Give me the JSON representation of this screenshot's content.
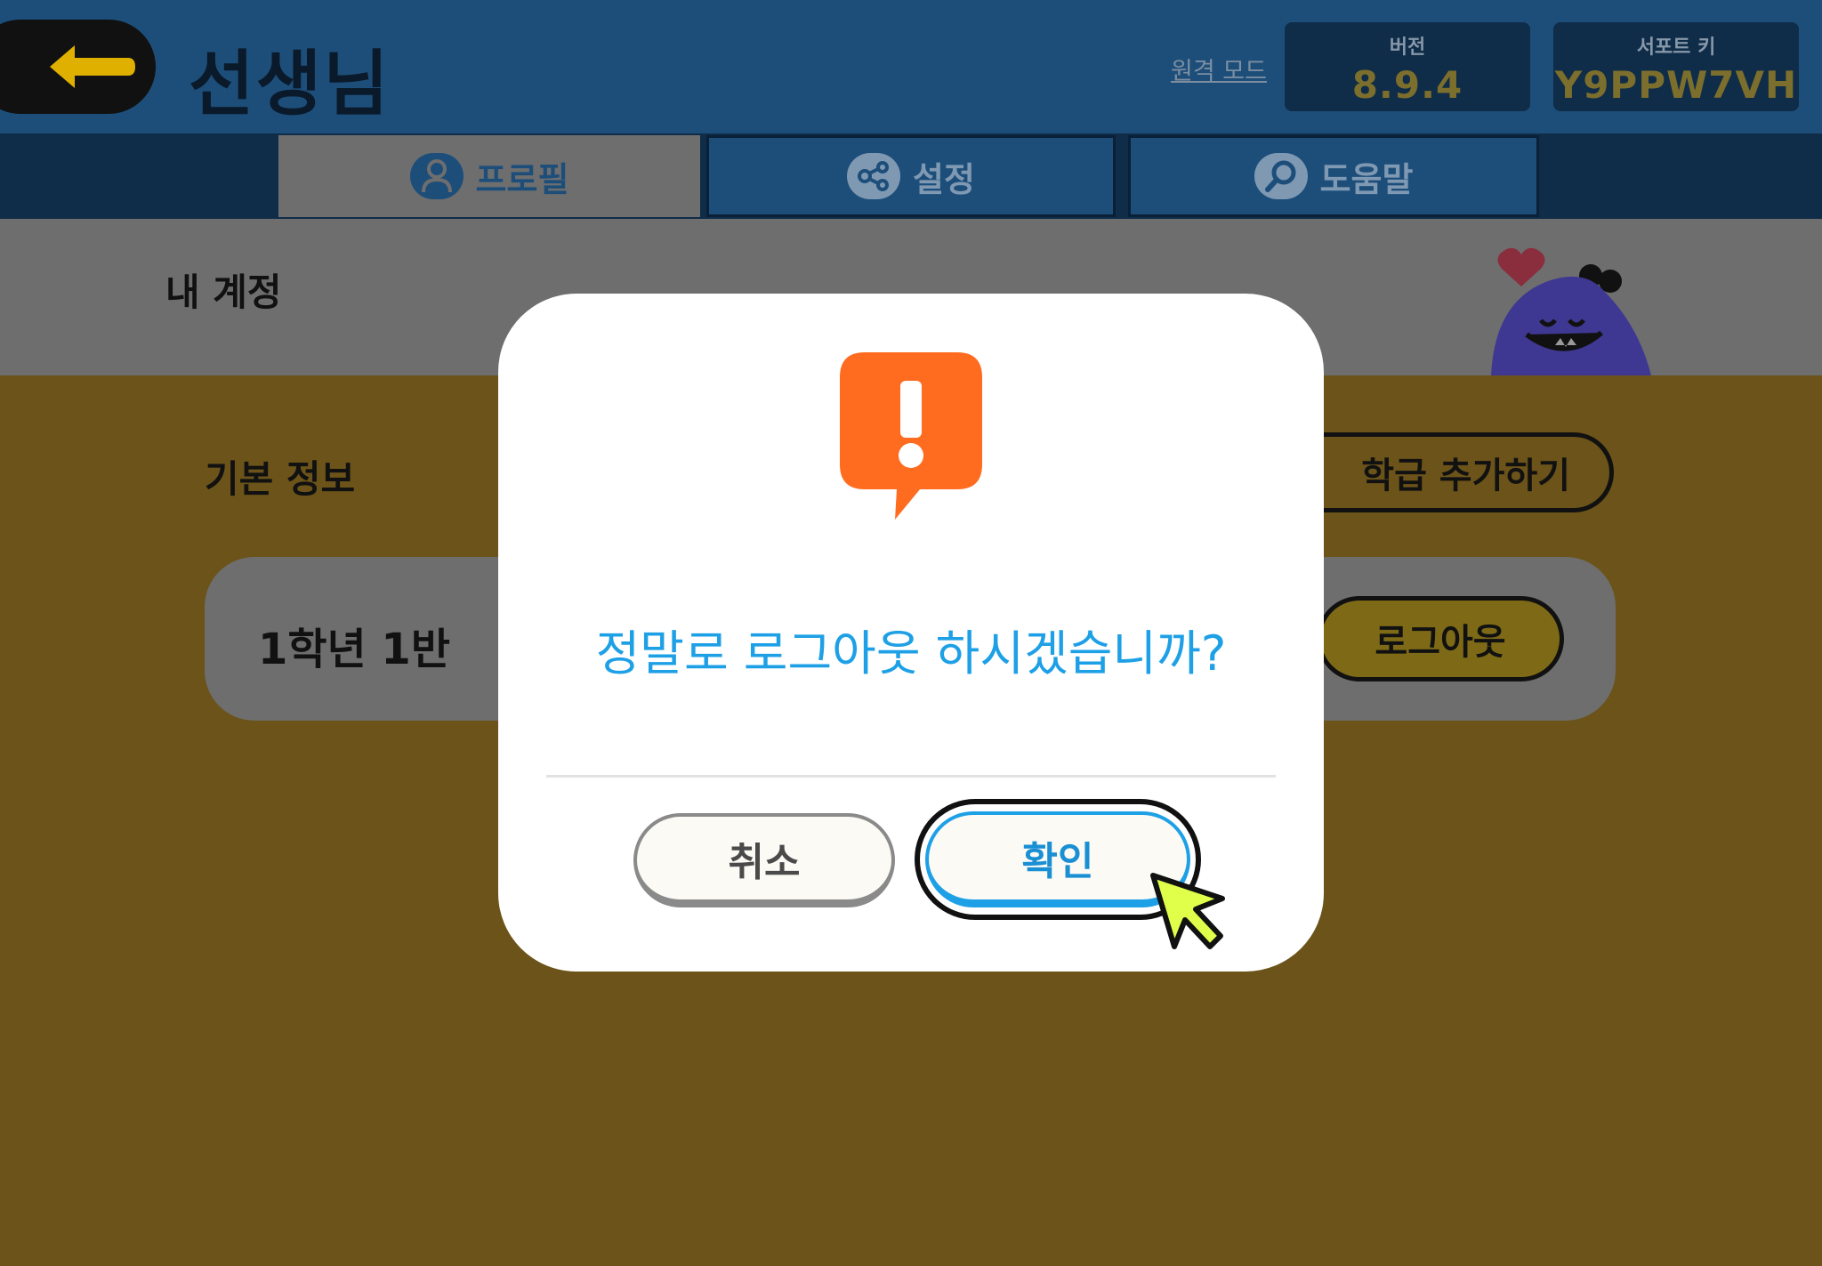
{
  "header": {
    "title": "선생님",
    "remote_mode": "원격 모드",
    "version_label": "버전",
    "version_value": "8.9.4",
    "support_label": "서포트 키",
    "support_value": "Y9PPW7VH",
    "back_icon": "arrow-left-icon"
  },
  "tabs": [
    {
      "label": "프로필",
      "icon": "user-icon",
      "active": true
    },
    {
      "label": "설정",
      "icon": "share-nodes-icon",
      "active": false
    },
    {
      "label": "도움말",
      "icon": "magnifier-icon",
      "active": false
    }
  ],
  "account": {
    "title": "내 계정"
  },
  "main": {
    "section_title": "기본 정보",
    "add_class_label": "학급 추가하기",
    "class_name": "1학년 1반",
    "logout_label": "로그아웃"
  },
  "dialog": {
    "message": "정말로 로그아웃 하시겠습니까?",
    "cancel_label": "취소",
    "confirm_label": "확인",
    "icon": "exclamation-alert-icon"
  },
  "colors": {
    "header_blue": "#1d4e7a",
    "accent_blue": "#1ea0e6",
    "alert_orange": "#ff6b1f",
    "cursor_lime": "#dfff4a"
  }
}
